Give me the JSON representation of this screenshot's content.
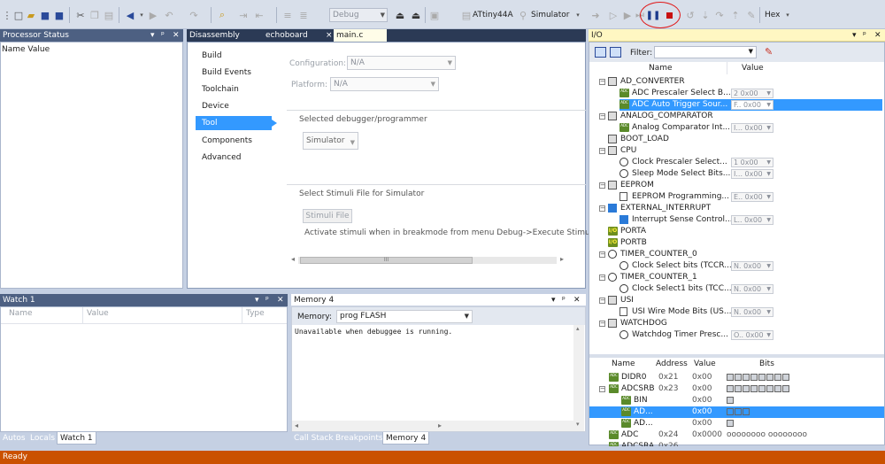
{
  "toolbar": {
    "config_combo": "Debug",
    "device_label": "ATtiny44A",
    "tool_label": "Simulator",
    "format_label": "Hex",
    "highlight_color": "#e01818"
  },
  "processor_status": {
    "title": "Processor Status",
    "header": "Name Value"
  },
  "doc_tabs": [
    "Disassembly",
    "echoboard",
    "main.c"
  ],
  "doc_tab_close": "×",
  "project": {
    "nav": [
      "Build",
      "Build Events",
      "Toolchain",
      "Device",
      "Tool",
      "Components",
      "Advanced"
    ],
    "selected_nav": "Tool",
    "configuration_label": "Configuration:",
    "configuration_value": "N/A",
    "platform_label": "Platform:",
    "platform_value": "N/A",
    "debugger_group": "Selected debugger/programmer",
    "debugger_value": "Simulator",
    "stimuli_group": "Select Stimuli File for Simulator",
    "stimuli_button": "Stimuli File",
    "stimuli_hint": "Activate stimuli when in breakmode from menu Debug->Execute Stimuli",
    "scroll_thumb": "III"
  },
  "watch": {
    "title": "Watch 1",
    "columns": [
      "Name",
      "Value",
      "Type"
    ],
    "tabs": [
      "Autos",
      "Locals",
      "Watch 1"
    ]
  },
  "memory": {
    "title": "Memory 4",
    "memory_label": "Memory:",
    "memory_value": "prog FLASH",
    "content": "Unavailable when debuggee is running.",
    "tabs": [
      "Call Stack",
      "Breakpoints",
      "Memory 4"
    ]
  },
  "io": {
    "title": "I/O",
    "filter_label": "Filter:",
    "columns": [
      "Name",
      "Value"
    ],
    "rows": [
      {
        "name": "AD_CONVERTER",
        "value": "",
        "level": 0,
        "icon": "chip-icon",
        "expander": "−"
      },
      {
        "name": "ADC  Prescaler Select B...",
        "value": "2  0x00",
        "level": 1,
        "icon": "adc-icon"
      },
      {
        "name": "ADC Auto Trigger Sour...",
        "value": "F..  0x00",
        "level": 1,
        "icon": "adc-icon",
        "selected": true
      },
      {
        "name": "ANALOG_COMPARATOR",
        "value": "",
        "level": 0,
        "icon": "chip-icon",
        "expander": "−"
      },
      {
        "name": "Analog Comparator Int...",
        "value": "I...  0x00",
        "level": 1,
        "icon": "adc-icon"
      },
      {
        "name": "BOOT_LOAD",
        "value": "",
        "level": 0,
        "icon": "chip-icon",
        "expander": ""
      },
      {
        "name": "CPU",
        "value": "",
        "level": 0,
        "icon": "chip-icon",
        "expander": "−"
      },
      {
        "name": "Clock Prescaler Select...",
        "value": "1  0x00",
        "level": 1,
        "icon": "clock-icon"
      },
      {
        "name": "Sleep Mode Select Bits...",
        "value": "I...  0x00",
        "level": 1,
        "icon": "clock-icon"
      },
      {
        "name": "EEPROM",
        "value": "",
        "level": 0,
        "icon": "chip-icon",
        "expander": "−"
      },
      {
        "name": "EEPROM Programming...",
        "value": "E..  0x00",
        "level": 1,
        "icon": "doc-icon"
      },
      {
        "name": "EXTERNAL_INTERRUPT",
        "value": "",
        "level": 0,
        "icon": "bolt-icon",
        "expander": "−"
      },
      {
        "name": "Interrupt Sense Control...",
        "value": "L..  0x00",
        "level": 1,
        "icon": "bolt-icon"
      },
      {
        "name": "PORTA",
        "value": "",
        "level": 0,
        "icon": "io-icon",
        "expander": ""
      },
      {
        "name": "PORTB",
        "value": "",
        "level": 0,
        "icon": "io-icon",
        "expander": ""
      },
      {
        "name": "TIMER_COUNTER_0",
        "value": "",
        "level": 0,
        "icon": "clock-icon",
        "expander": "−"
      },
      {
        "name": "Clock Select bits (TCCR...",
        "value": "N.  0x00",
        "level": 1,
        "icon": "clock-icon"
      },
      {
        "name": "TIMER_COUNTER_1",
        "value": "",
        "level": 0,
        "icon": "clock-icon",
        "expander": "−"
      },
      {
        "name": "Clock Select1 bits (TCC...",
        "value": "N.  0x00",
        "level": 1,
        "icon": "clock-icon"
      },
      {
        "name": "USI",
        "value": "",
        "level": 0,
        "icon": "chip-icon",
        "expander": "−"
      },
      {
        "name": "USI Wire Mode Bits (US...",
        "value": "N.  0x00",
        "level": 1,
        "icon": "doc-icon"
      },
      {
        "name": "WATCHDOG",
        "value": "",
        "level": 0,
        "icon": "chip-icon",
        "expander": "−"
      },
      {
        "name": "Watchdog Timer Presc...",
        "value": "O..  0x00",
        "level": 1,
        "icon": "clock-icon"
      }
    ],
    "reg_columns": [
      "Name",
      "Address",
      "Value",
      "Bits"
    ],
    "registers": [
      {
        "name": "DIDR0",
        "address": "0x21",
        "value": "0x00",
        "bits": 8,
        "expander": "",
        "level": 0
      },
      {
        "name": "ADCSRB",
        "address": "0x23",
        "value": "0x00",
        "bits": 8,
        "expander": "−",
        "level": 0
      },
      {
        "name": "BIN",
        "address": "",
        "value": "0x00",
        "bits": 1,
        "expander": "",
        "level": 1
      },
      {
        "name": "AD...",
        "address": "",
        "value": "0x00",
        "bits": 3,
        "expander": "",
        "level": 1,
        "selected": true
      },
      {
        "name": "AD...",
        "address": "",
        "value": "0x00",
        "bits": 1,
        "expander": "",
        "level": 1
      },
      {
        "name": "ADC",
        "address": "0x24",
        "value": "0x0000",
        "bits_text": "oooooooo  oooooooo",
        "expander": "",
        "level": 0
      },
      {
        "name": "ADCSRA",
        "address": "0x26",
        "value": "",
        "bits": 0,
        "expander": "",
        "level": 0
      }
    ]
  },
  "status": {
    "text": "Ready",
    "color": "#ca5100"
  }
}
